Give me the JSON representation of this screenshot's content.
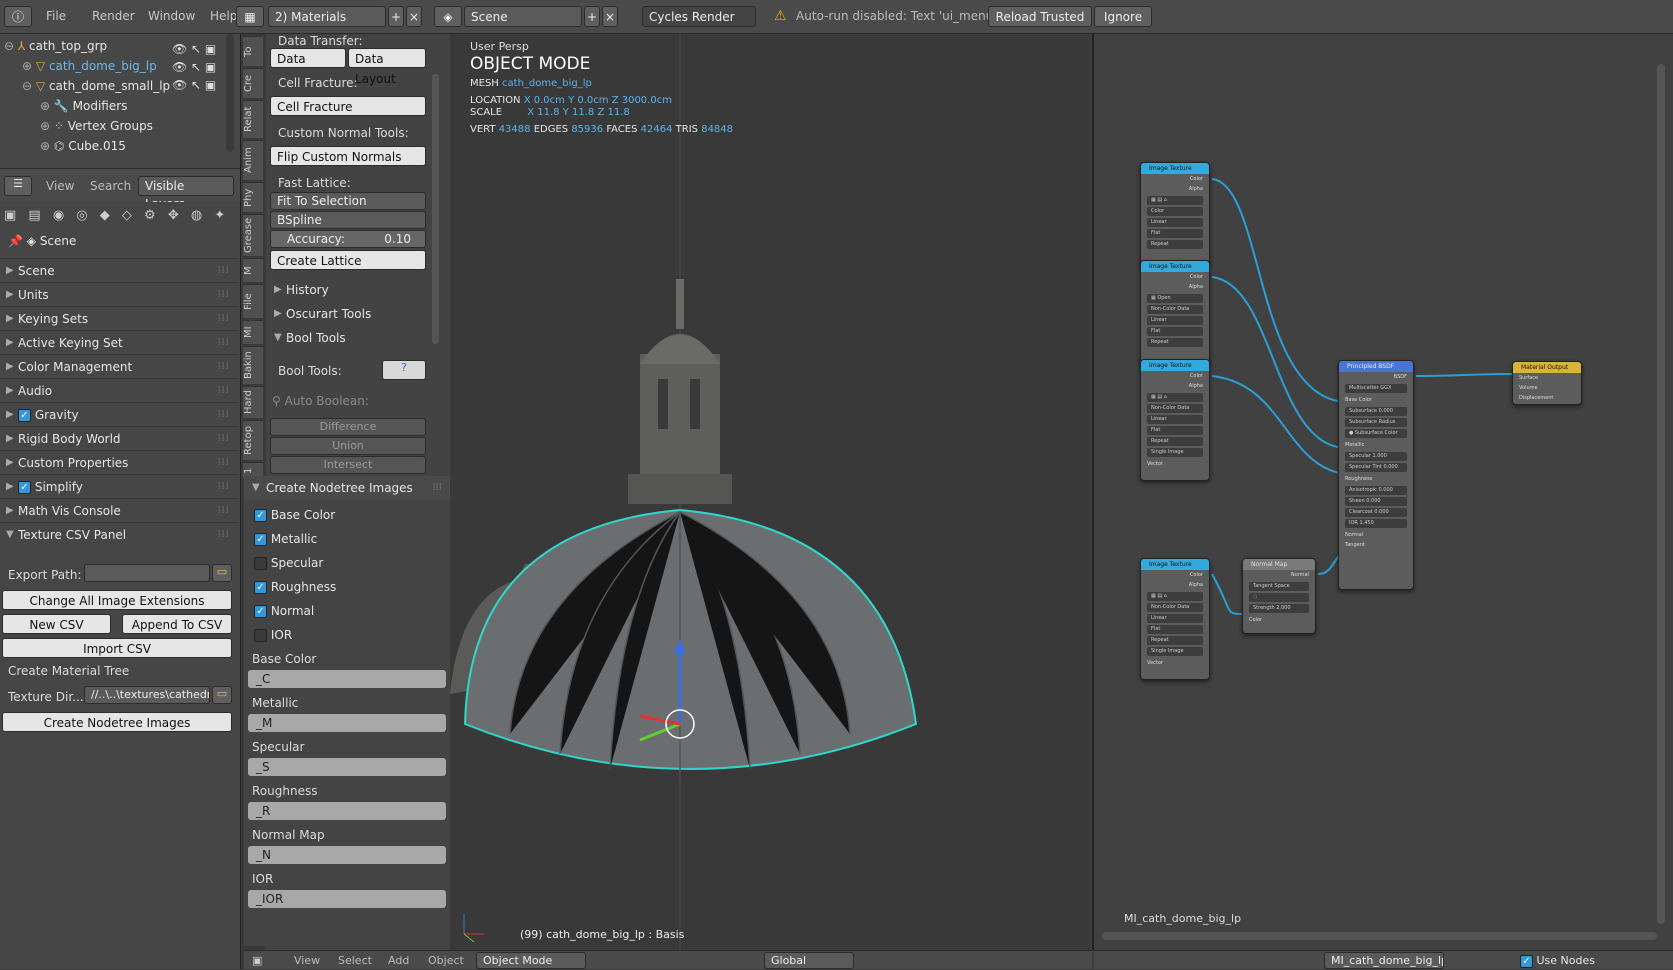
{
  "topbar": {
    "menus": [
      "File",
      "Render",
      "Window",
      "Help"
    ],
    "screen": "2) Materials",
    "scene": "Scene",
    "engine": "Cycles Render",
    "warning": "Auto-run disabled: Text 'ui_menu.py'",
    "reload": "Reload Trusted",
    "ignore": "Ignore"
  },
  "outliner": {
    "items": [
      {
        "label": "cath_top_grp",
        "selected": false
      },
      {
        "label": "cath_dome_big_lp",
        "selected": true
      },
      {
        "label": "cath_dome_small_lp",
        "selected": false
      },
      {
        "label": "Modifiers",
        "selected": false
      },
      {
        "label": "Vertex Groups",
        "selected": false
      },
      {
        "label": "Cube.015",
        "selected": false
      }
    ],
    "tabs": [
      "View",
      "Search",
      "Visible Layers"
    ]
  },
  "properties": {
    "context": "Scene",
    "panels": [
      "Scene",
      "Units",
      "Keying Sets",
      "Active Keying Set",
      "Color Management",
      "Audio",
      "Gravity",
      "Rigid Body World",
      "Custom Properties",
      "Simplify",
      "Math Vis Console",
      "Texture CSV Panel"
    ],
    "export_path_label": "Export Path:",
    "change_ext": "Change All Image Extensions",
    "new_csv": "New CSV",
    "append_csv": "Append To CSV",
    "import_csv": "Import CSV",
    "create_material_tree": "Create Material Tree",
    "texture_dir_label": "Texture Dir...",
    "texture_dir_value": "//..\\..\\textures\\cathedral\\",
    "create_nodetree": "Create Nodetree Images"
  },
  "toolshelf": {
    "vtabs": [
      "To",
      "Cre",
      "Relat",
      "Anim",
      "Phy",
      "Grease",
      "M",
      "File",
      "MI",
      "Bakin",
      "Hard",
      "Retop",
      "1"
    ],
    "data_transfer": "Data Transfer:",
    "data": "Data",
    "data_layout": "Data Layout",
    "cell_fracture_label": "Cell Fracture:",
    "cell_fracture": "Cell Fracture",
    "custom_normal_label": "Custom Normal Tools:",
    "flip_normals": "Flip Custom Normals",
    "fast_lattice_label": "Fast Lattice:",
    "fit_to_selection": "Fit To Selection",
    "bspline": "BSpline",
    "accuracy_label": "Accuracy:",
    "accuracy_value": "0.10",
    "create_lattice": "Create Lattice",
    "history": "History",
    "oscurart": "Oscurart Tools",
    "bool_tools": "Bool Tools",
    "bool_tools_label": "Bool Tools:",
    "auto_boolean": "Auto Boolean:",
    "difference": "Difference",
    "union": "Union",
    "intersect": "Intersect",
    "create_nodetree": "Create Nodetree Images",
    "checks": [
      {
        "label": "Base Color",
        "checked": true
      },
      {
        "label": "Metallic",
        "checked": true
      },
      {
        "label": "Specular",
        "checked": false
      },
      {
        "label": "Roughness",
        "checked": true
      },
      {
        "label": "Normal",
        "checked": true
      },
      {
        "label": "IOR",
        "checked": false
      }
    ],
    "suffixes": [
      {
        "label": "Base Color",
        "value": "_C"
      },
      {
        "label": "Metallic",
        "value": "_M"
      },
      {
        "label": "Specular",
        "value": "_S"
      },
      {
        "label": "Roughness",
        "value": "_R"
      },
      {
        "label": "Normal Map",
        "value": "_N"
      },
      {
        "label": "IOR",
        "value": "_IOR"
      }
    ]
  },
  "viewport": {
    "persp": "User Persp",
    "mode_title": "OBJECT MODE",
    "mesh_label": "MESH",
    "mesh_name": "cath_dome_big_lp",
    "location_label": "LOCATION",
    "location": "X 0.0cm  Y  0.0cm  Z 3000.0cm",
    "scale_label": "SCALE",
    "scale": "X 11.8  Y 11.8  Z 11.8",
    "vert_label": "VERT",
    "vert": "43488",
    "edges_label": "EDGES",
    "edges": "85936",
    "faces_label": "FACES",
    "faces": "42464",
    "tris_label": "TRIS",
    "tris": "84848",
    "status": "(99) cath_dome_big_lp : Basis"
  },
  "node_editor": {
    "material_name": "MI_cath_dome_big_lp",
    "use_nodes": "Use Nodes"
  },
  "bottombar": {
    "view": "View",
    "select": "Select",
    "add": "Add",
    "object": "Object",
    "mode": "Object Mode",
    "orientation": "Global"
  },
  "colors": {
    "accent": "#3399dd",
    "selection_outline": "#2fd6c9",
    "principled_header": "#4a73d6",
    "output_header": "#d9b33a",
    "texture_header": "#33aadd"
  }
}
